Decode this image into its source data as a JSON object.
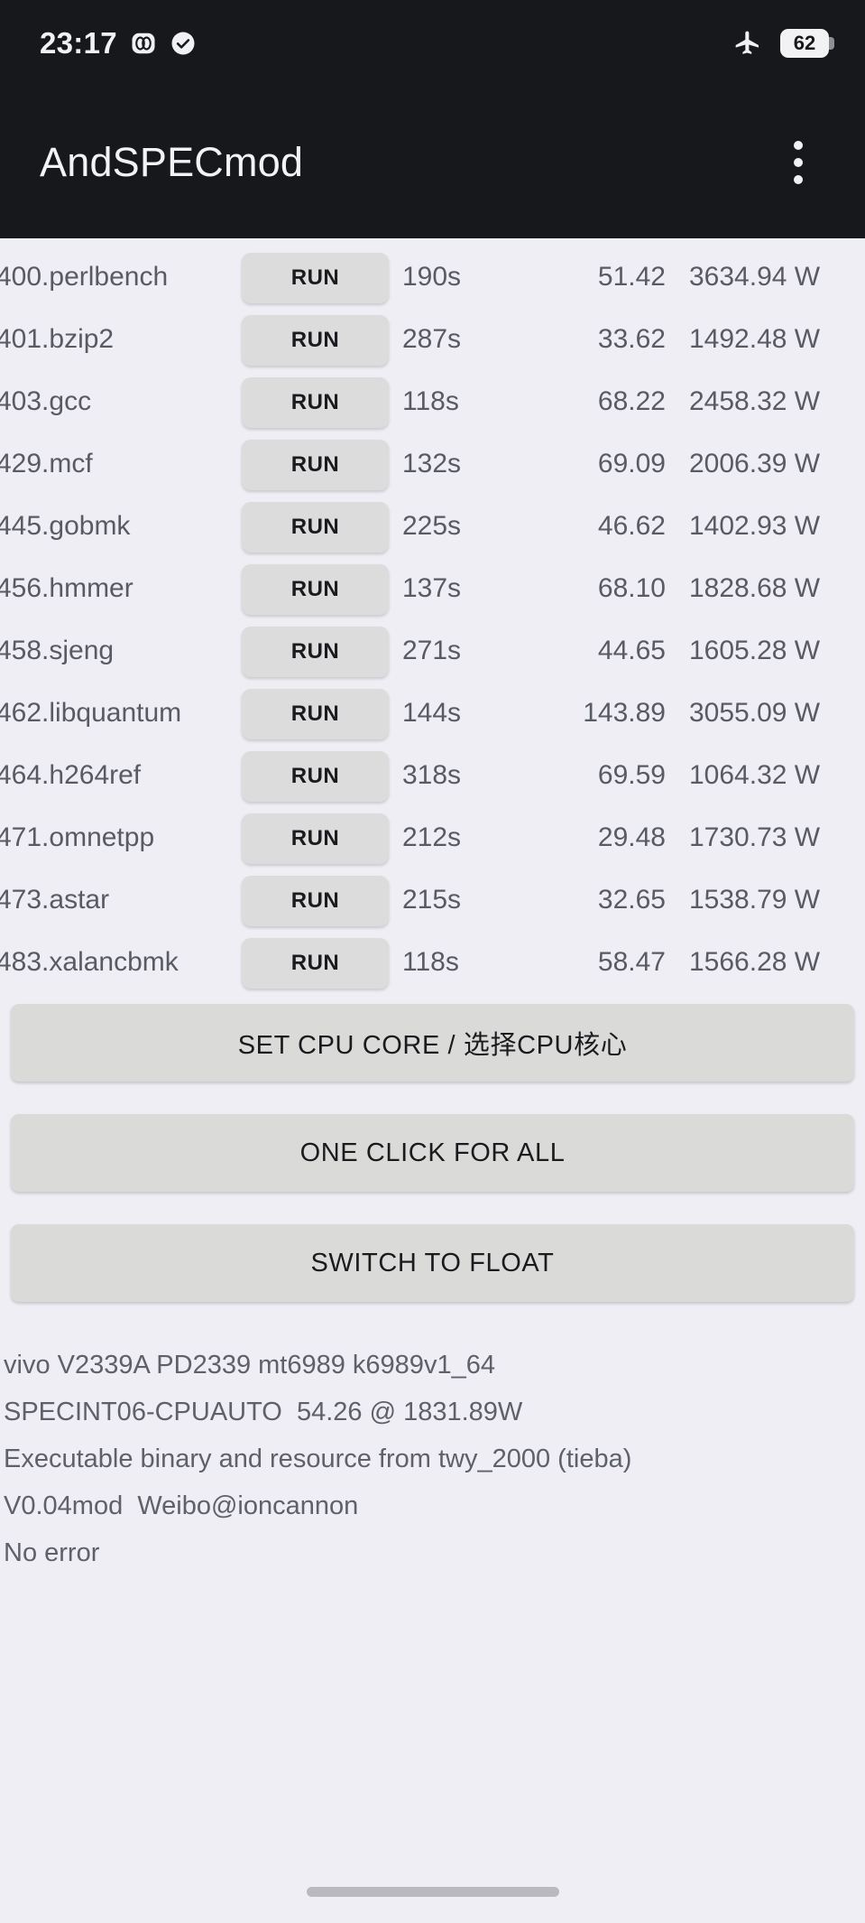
{
  "statusbar": {
    "time": "23:17",
    "icons": [
      "dual-sim-icon",
      "check-circle-icon"
    ],
    "airplane_icon": "airplane-mode-icon",
    "battery_level": "62"
  },
  "appbar": {
    "title": "AndSPECmod",
    "overflow_icon": "more-vertical-icon"
  },
  "benchmarks": {
    "run_label": "RUN",
    "rows": [
      {
        "name": "400.perlbench",
        "time": "190s",
        "score": "51.42",
        "power": "3634.94 W"
      },
      {
        "name": "401.bzip2",
        "time": "287s",
        "score": "33.62",
        "power": "1492.48 W"
      },
      {
        "name": "403.gcc",
        "time": "118s",
        "score": "68.22",
        "power": "2458.32 W"
      },
      {
        "name": "429.mcf",
        "time": "132s",
        "score": "69.09",
        "power": "2006.39 W"
      },
      {
        "name": "445.gobmk",
        "time": "225s",
        "score": "46.62",
        "power": "1402.93 W"
      },
      {
        "name": "456.hmmer",
        "time": "137s",
        "score": "68.10",
        "power": "1828.68 W"
      },
      {
        "name": "458.sjeng",
        "time": "271s",
        "score": "44.65",
        "power": "1605.28 W"
      },
      {
        "name": "462.libquantum",
        "time": "144s",
        "score": "143.89",
        "power": "3055.09 W"
      },
      {
        "name": "464.h264ref",
        "time": "318s",
        "score": "69.59",
        "power": "1064.32 W"
      },
      {
        "name": "471.omnetpp",
        "time": "212s",
        "score": "29.48",
        "power": "1730.73 W"
      },
      {
        "name": "473.astar",
        "time": "215s",
        "score": "32.65",
        "power": "1538.79 W"
      },
      {
        "name": "483.xalancbmk",
        "time": "118s",
        "score": "58.47",
        "power": "1566.28 W"
      }
    ]
  },
  "actions": {
    "set_cpu_core": "SET CPU CORE / 选择CPU核心",
    "one_click_for_all": "ONE CLICK FOR ALL",
    "switch_to_float": "SWITCH TO FLOAT"
  },
  "info": {
    "line1": "vivo V2339A PD2339 mt6989 k6989v1_64",
    "line2": "SPECINT06-CPUAUTO  54.26 @ 1831.89W",
    "line3": "Executable binary and resource from twy_2000 (tieba)",
    "line4": "V0.04mod  Weibo@ioncannon",
    "line5": "No error"
  },
  "colors": {
    "statusbar_bg": "#17181c",
    "appbar_bg": "#17181c",
    "page_bg": "#eeeef4",
    "run_button_bg": "#dcdcdc",
    "action_button_bg": "#dadbd8",
    "text_muted": "#595b63"
  }
}
